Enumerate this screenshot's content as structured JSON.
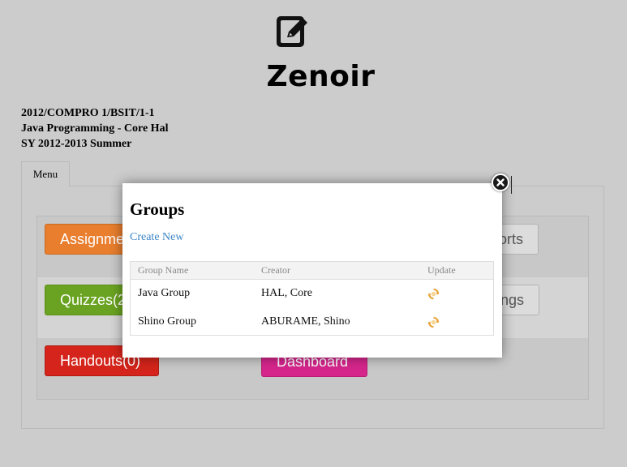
{
  "app": {
    "title": "Zenoir",
    "logo_icon": "edit-pencil-icon"
  },
  "course": {
    "line1": "2012/COMPRO 1/BSIT/1-1",
    "line2": "Java Programming - Core Hal",
    "line3": "SY 2012-2013 Summer"
  },
  "tabs": [
    {
      "label": "Menu"
    }
  ],
  "menu_buttons": {
    "assignments": {
      "label": "Assignme",
      "color": "#e87e2e"
    },
    "quizzes": {
      "label": "Quizzes(2",
      "color": "#6aa321"
    },
    "handouts": {
      "label": "Handouts(0)",
      "color": "#d4241b"
    },
    "dashboard": {
      "label": "Dashboard",
      "color": "#d5268c"
    },
    "reports": {
      "label": "orts",
      "color": "#dcdcdc"
    },
    "settings": {
      "label": "ngs",
      "color": "#dcdcdc"
    }
  },
  "modal": {
    "title": "Groups",
    "create_link": "Create New",
    "close_icon": "close-icon",
    "columns": [
      "Group Name",
      "Creator",
      "Update"
    ],
    "rows": [
      {
        "group_name": "Java Group",
        "creator": "HAL, Core",
        "update_icon": "refresh-icon"
      },
      {
        "group_name": "Shino Group",
        "creator": "ABURAME, Shino",
        "update_icon": "refresh-icon"
      }
    ]
  }
}
